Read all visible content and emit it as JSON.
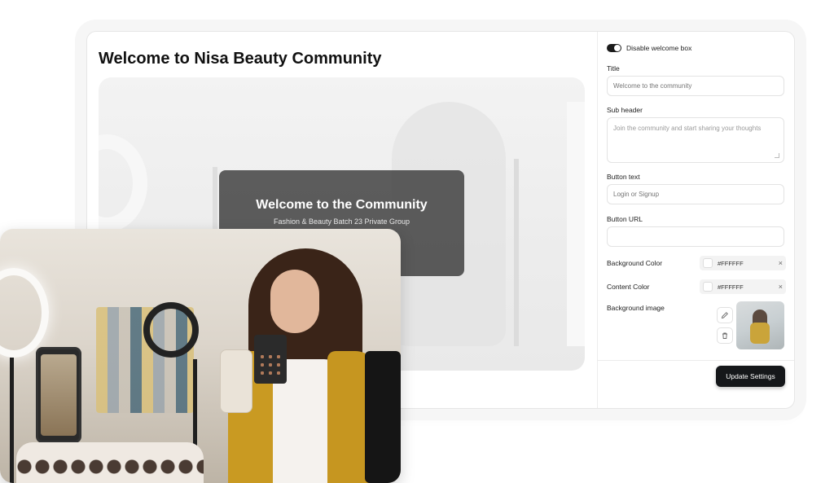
{
  "preview": {
    "page_title": "Welcome to Nisa Beauty Community",
    "welcome_title": "Welcome to the Community",
    "welcome_subtitle": "Fashion & Beauty Batch 23 Private Group"
  },
  "settings": {
    "toggle_label": "Disable welcome box",
    "toggle_on": true,
    "title_label": "Title",
    "title_placeholder": "Welcome to the community",
    "subheader_label": "Sub header",
    "subheader_placeholder": "Join the community and start sharing your thoughts",
    "button_text_label": "Button text",
    "button_text_placeholder": "Login or Signup",
    "button_url_label": "Button URL",
    "button_url_value": "",
    "background_color_label": "Background Color",
    "background_color_value": "#FFFFFF",
    "content_color_label": "Content Color",
    "content_color_value": "#FFFFFF",
    "background_image_label": "Background image",
    "clear_symbol": "×",
    "update_button": "Update Settings"
  },
  "icons": {
    "edit": "pencil-icon",
    "delete": "trash-icon"
  },
  "colors": {
    "primary_button": "#15171A",
    "toggle_active": "#1B1B1B"
  }
}
